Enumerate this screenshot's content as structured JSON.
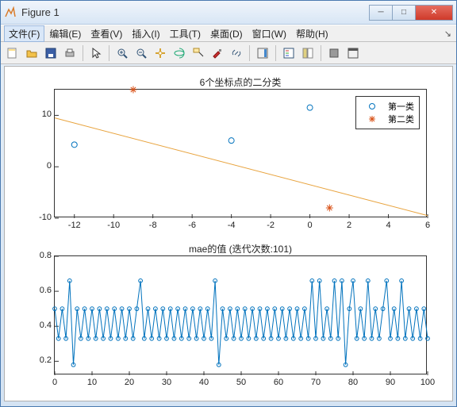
{
  "window": {
    "title": "Figure 1"
  },
  "menubar": {
    "items": [
      {
        "label": "文件(F)"
      },
      {
        "label": "编辑(E)"
      },
      {
        "label": "查看(V)"
      },
      {
        "label": "插入(I)"
      },
      {
        "label": "工具(T)"
      },
      {
        "label": "桌面(D)"
      },
      {
        "label": "窗口(W)"
      },
      {
        "label": "帮助(H)"
      }
    ]
  },
  "toolbar": {
    "buttons": [
      "new-figure-icon",
      "open-icon",
      "save-icon",
      "print-icon",
      "sep",
      "pointer-icon",
      "sep",
      "zoom-in-icon",
      "zoom-out-icon",
      "pan-icon",
      "rotate3d-icon",
      "datacursor-icon",
      "brush-icon",
      "link-icon",
      "sep",
      "colorbar-icon",
      "sep",
      "insert-legend-icon",
      "plot-tools-icon",
      "sep",
      "hide-tools-icon",
      "dock-icon"
    ]
  },
  "chart_data": [
    {
      "type": "scatter",
      "title": "6个坐标点的二分类",
      "xlim": [
        -13,
        6
      ],
      "ylim": [
        -10,
        15
      ],
      "xticks": [
        -12,
        -10,
        -8,
        -6,
        -4,
        -2,
        0,
        2,
        4,
        6
      ],
      "yticks": [
        -10,
        0,
        10
      ],
      "series": [
        {
          "name": "第一类",
          "marker": "o",
          "color": "#0072bd",
          "points": [
            {
              "x": -12,
              "y": 4.3
            },
            {
              "x": -4,
              "y": 5.1
            },
            {
              "x": 0,
              "y": 11.5
            }
          ]
        },
        {
          "name": "第二类",
          "marker": "*",
          "color": "#d95319",
          "points": [
            {
              "x": -9,
              "y": 15
            },
            {
              "x": 1,
              "y": -8
            },
            {
              "x": 5.3,
              "y": 9.2
            }
          ]
        }
      ],
      "line": {
        "color": "#e8a33d",
        "x1": -13,
        "y1": 9.5,
        "x2": 6,
        "y2": -9.5
      },
      "legend": {
        "entries": [
          "第一类",
          "第二类"
        ]
      }
    },
    {
      "type": "line",
      "title": "mae的值 (迭代次数:101)",
      "xlim": [
        0,
        100
      ],
      "ylim": [
        0.12,
        0.8
      ],
      "xticks": [
        0,
        10,
        20,
        30,
        40,
        50,
        60,
        70,
        80,
        90,
        100
      ],
      "yticks": [
        0.2,
        0.4,
        0.6,
        0.8
      ],
      "series": [
        {
          "name": "mae",
          "color": "#0072bd",
          "marker": "o",
          "y": [
            0.5,
            0.33,
            0.5,
            0.33,
            0.66,
            0.18,
            0.5,
            0.33,
            0.5,
            0.33,
            0.5,
            0.33,
            0.5,
            0.33,
            0.5,
            0.33,
            0.5,
            0.33,
            0.5,
            0.33,
            0.5,
            0.33,
            0.5,
            0.66,
            0.33,
            0.5,
            0.33,
            0.5,
            0.33,
            0.5,
            0.33,
            0.5,
            0.33,
            0.5,
            0.33,
            0.5,
            0.33,
            0.5,
            0.33,
            0.5,
            0.33,
            0.5,
            0.33,
            0.66,
            0.18,
            0.5,
            0.33,
            0.5,
            0.33,
            0.5,
            0.33,
            0.5,
            0.33,
            0.5,
            0.33,
            0.5,
            0.33,
            0.5,
            0.33,
            0.5,
            0.33,
            0.5,
            0.33,
            0.5,
            0.33,
            0.5,
            0.33,
            0.5,
            0.33,
            0.66,
            0.33,
            0.66,
            0.33,
            0.5,
            0.33,
            0.66,
            0.33,
            0.66,
            0.18,
            0.5,
            0.66,
            0.33,
            0.5,
            0.33,
            0.66,
            0.33,
            0.5,
            0.33,
            0.5,
            0.66,
            0.33,
            0.5,
            0.33,
            0.66,
            0.33,
            0.5,
            0.33,
            0.5,
            0.33,
            0.5,
            0.33
          ]
        }
      ]
    }
  ]
}
